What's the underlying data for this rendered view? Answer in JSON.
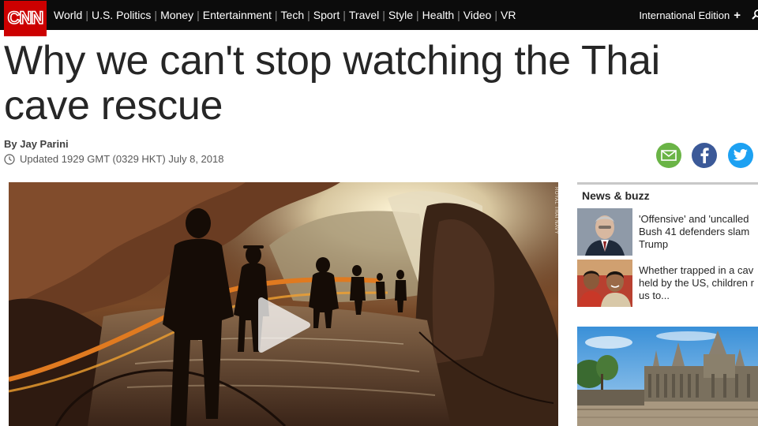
{
  "header": {
    "logo_text": "CNN",
    "nav": [
      "World",
      "U.S. Politics",
      "Money",
      "Entertainment",
      "Tech",
      "Sport",
      "Travel",
      "Style",
      "Health",
      "Video",
      "VR"
    ],
    "separator": "|",
    "edition_label": "International Edition",
    "edition_plus": "+",
    "colors": {
      "bar": "#0c0c0c",
      "logo": "#cc0000"
    }
  },
  "article": {
    "headline": "Why we can't stop watching the Thai cave rescue",
    "byline": "By Jay Parini",
    "updated": "Updated 1929 GMT (0329 HKT) July 8, 2018"
  },
  "share": {
    "icons": [
      "email-icon",
      "facebook-icon",
      "twitter-icon"
    ],
    "colors": {
      "email": "#6ab446",
      "facebook": "#3b5998",
      "twitter": "#1da1f2"
    }
  },
  "video": {
    "credit": "ROYAL THAI NAVY",
    "icon": "play-icon"
  },
  "sidebar": {
    "section_title": "News & buzz",
    "items": [
      {
        "text": "'Offensive' and 'uncalled Bush 41 defenders slam Trump"
      },
      {
        "text": "Whether trapped in a cav held by the US, children r us to..."
      }
    ]
  }
}
